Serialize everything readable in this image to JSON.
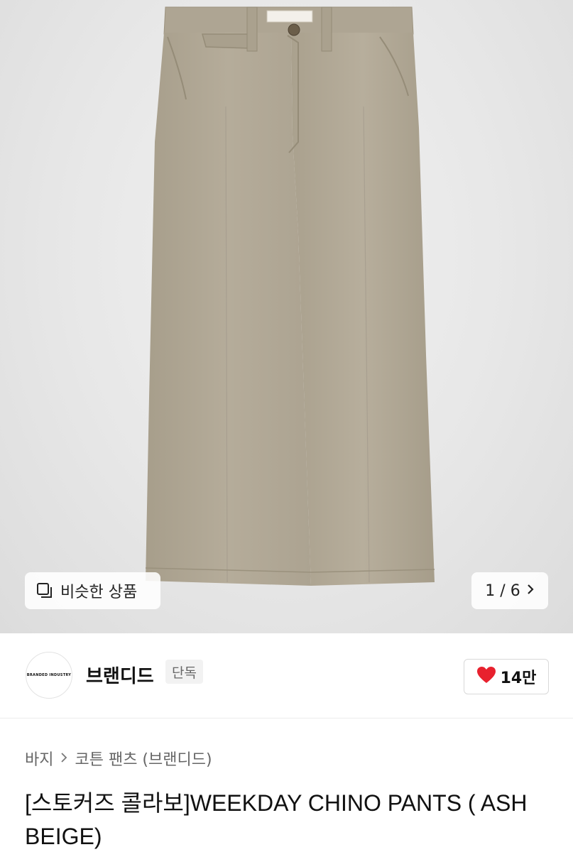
{
  "gallery": {
    "similar_label": "비슷한 상품",
    "pager_text": "1 / 6",
    "pants_color": "#b3aa98"
  },
  "seller": {
    "logo_text": "BRANDED INDUSTRY",
    "name": "브랜디드",
    "badge": "단독",
    "like_count": "14만",
    "like_color": "#e8212e"
  },
  "breadcrumb": {
    "category": "바지",
    "subcategory": "코튼 팬츠 (브랜디드)"
  },
  "product": {
    "title": "[스토커즈 콜라보]WEEKDAY CHINO PANTS ( ASH BEIGE)"
  }
}
